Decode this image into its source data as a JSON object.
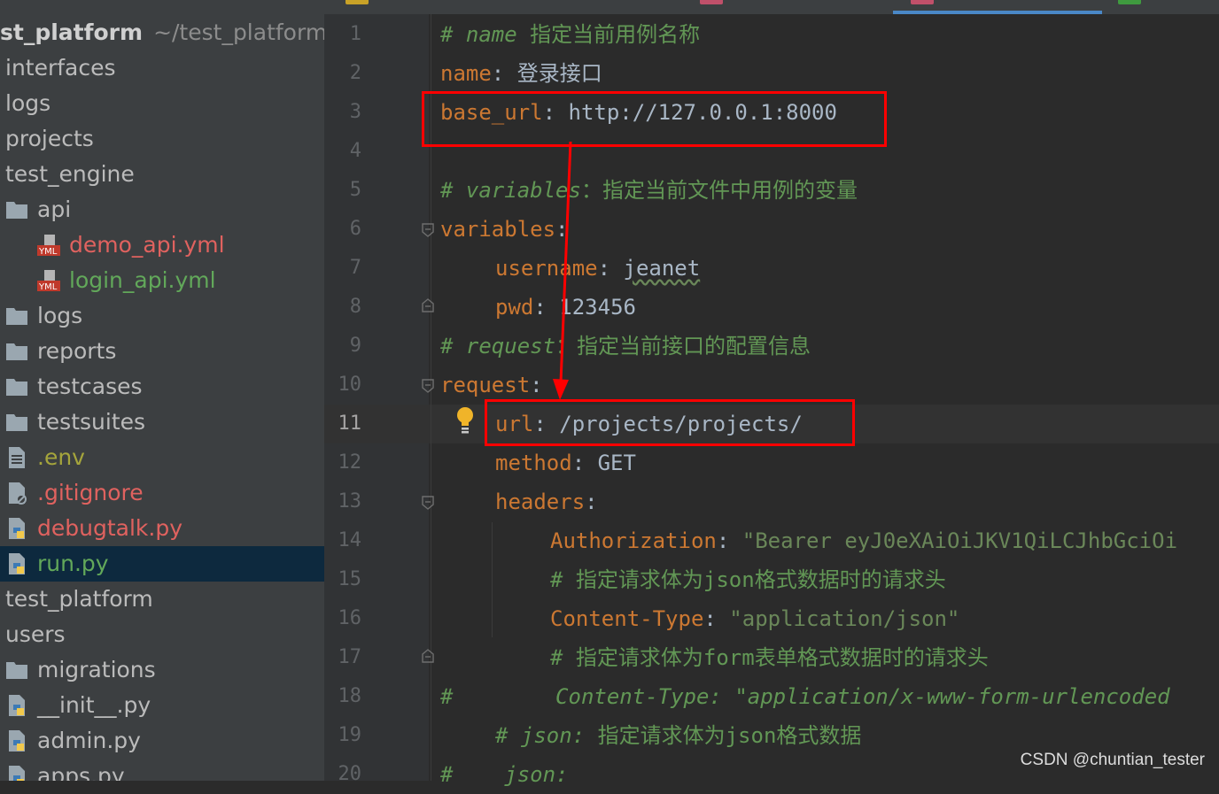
{
  "project_tree": {
    "root": {
      "name": "st_platform",
      "path": "~/test_platform/t"
    },
    "rows": [
      {
        "label": "interfaces",
        "icon": "none",
        "color": "default"
      },
      {
        "label": "logs",
        "icon": "none",
        "color": "default"
      },
      {
        "label": "projects",
        "icon": "none",
        "color": "default"
      },
      {
        "label": "test_engine",
        "icon": "none",
        "color": "default"
      },
      {
        "label": "api",
        "icon": "folder-icon",
        "color": "default"
      },
      {
        "label": "demo_api.yml",
        "icon": "yml-file-icon",
        "color": "red"
      },
      {
        "label": "login_api.yml",
        "icon": "yml-file-icon",
        "color": "green"
      },
      {
        "label": "logs",
        "icon": "folder-icon",
        "color": "default"
      },
      {
        "label": "reports",
        "icon": "folder-icon",
        "color": "default"
      },
      {
        "label": "testcases",
        "icon": "folder-icon",
        "color": "default"
      },
      {
        "label": "testsuites",
        "icon": "folder-icon",
        "color": "default"
      },
      {
        "label": ".env",
        "icon": "text-file-icon",
        "color": "olive"
      },
      {
        "label": ".gitignore",
        "icon": "ignored-file-icon",
        "color": "red"
      },
      {
        "label": "debugtalk.py",
        "icon": "python-file-icon",
        "color": "red"
      },
      {
        "label": "run.py",
        "icon": "python-file-icon",
        "color": "green",
        "selected": true
      },
      {
        "label": "test_platform",
        "icon": "none",
        "color": "default"
      },
      {
        "label": "users",
        "icon": "none",
        "color": "default"
      },
      {
        "label": "migrations",
        "icon": "folder-icon",
        "color": "default"
      },
      {
        "label": "__init__.py",
        "icon": "python-file-icon",
        "color": "default"
      },
      {
        "label": "admin.py",
        "icon": "python-file-icon",
        "color": "default"
      },
      {
        "label": "apps.py",
        "icon": "python-file-icon",
        "color": "default"
      }
    ]
  },
  "editor": {
    "current_line": 11,
    "lines": [
      {
        "n": "1",
        "c": "# name",
        "t": "指定当前用例名称"
      },
      {
        "n": "2",
        "k": "name",
        "v": "登录接口"
      },
      {
        "n": "3",
        "k": "base_url",
        "v": "http://127.0.0.1:8000"
      },
      {
        "n": "4"
      },
      {
        "n": "5",
        "c": "# variables",
        "t": "：指定当前文件中用例的变量"
      },
      {
        "n": "6",
        "k": "variables"
      },
      {
        "n": "7",
        "k": "username",
        "v": "jeanet"
      },
      {
        "n": "8",
        "k": "pwd",
        "v": "123456"
      },
      {
        "n": "9",
        "c": "# request",
        "t": "：指定当前接口的配置信息"
      },
      {
        "n": "10",
        "k": "request"
      },
      {
        "n": "11",
        "k": "url",
        "v": "/projects/projects/"
      },
      {
        "n": "12",
        "k": "method",
        "v": "GET"
      },
      {
        "n": "13",
        "k": "headers"
      },
      {
        "n": "14",
        "k": "Authorization",
        "v": "\"Bearer eyJ0eXAiOiJKV1QiLCJhbGciOi"
      },
      {
        "n": "15",
        "c": "# ",
        "t": "指定请求体为json格式数据时的请求头"
      },
      {
        "n": "16",
        "k": "Content-Type",
        "v": "\"application/json\""
      },
      {
        "n": "17",
        "c": "# ",
        "t": "指定请求体为form表单格式数据时的请求头"
      },
      {
        "n": "18",
        "c": "#        Content-Type: \"application/x-www-form-urlencoded"
      },
      {
        "n": "19",
        "c": "# json:",
        "t": " 指定请求体为json格式数据"
      },
      {
        "n": "20",
        "c": "#    json:"
      }
    ]
  },
  "watermark": "CSDN @chuntian_tester",
  "colors": {
    "sidebar_bg": "#3c3f41",
    "editor_bg": "#2b2b2b",
    "yaml_key": "#cc7832",
    "comment": "#629755",
    "value": "#a9b7c6",
    "annotation_box": "#ff0000",
    "annotation_arrow": "#ff0000",
    "vcs_modified_red": "#e0625f",
    "vcs_added_green": "#62a85a"
  }
}
